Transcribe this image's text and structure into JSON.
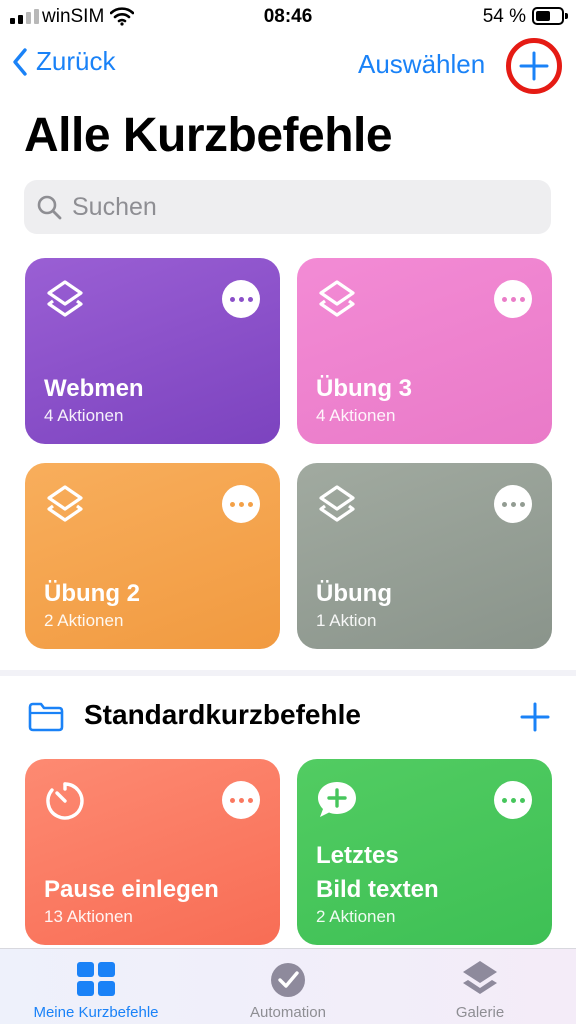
{
  "status_bar": {
    "carrier": "winSIM",
    "time": "08:46",
    "battery": "54 %"
  },
  "nav": {
    "back_label": "Zurück",
    "select_label": "Auswählen"
  },
  "page_title": "Alle Kurzbefehle",
  "search": {
    "placeholder": "Suchen"
  },
  "shortcuts": [
    {
      "title": "Webmen",
      "subtitle": "4 Aktionen",
      "icon": "layers-icon",
      "color": "#8a4fc8"
    },
    {
      "title": "Übung 3",
      "subtitle": "4 Aktionen",
      "icon": "layers-icon",
      "color": "#ef7fcf"
    },
    {
      "title": "Übung 2",
      "subtitle": "2 Aktionen",
      "icon": "layers-icon",
      "color": "#f4a04c"
    },
    {
      "title": "Übung",
      "subtitle": "1 Aktion",
      "icon": "layers-icon",
      "color": "#929c92"
    }
  ],
  "section": {
    "title": "Standardkurzbefehle",
    "icon": "folder-icon"
  },
  "default_shortcuts": [
    {
      "title": "Pause einlegen",
      "subtitle": "13 Aktionen",
      "icon": "timer-icon",
      "color": "#fb7a63"
    },
    {
      "title_line1": "Letztes",
      "title_line2": "Bild texten",
      "subtitle": "2 Aktionen",
      "icon": "message-plus-icon",
      "color": "#46c65c"
    }
  ],
  "tabs": [
    {
      "label": "Meine Kurzbefehle",
      "icon": "grid-icon",
      "active": true
    },
    {
      "label": "Automation",
      "icon": "clock-check-icon",
      "active": false
    },
    {
      "label": "Galerie",
      "icon": "layers-icon",
      "active": false
    }
  ],
  "colors": {
    "accent": "#1a82f7",
    "highlight_ring": "#e51b14"
  }
}
